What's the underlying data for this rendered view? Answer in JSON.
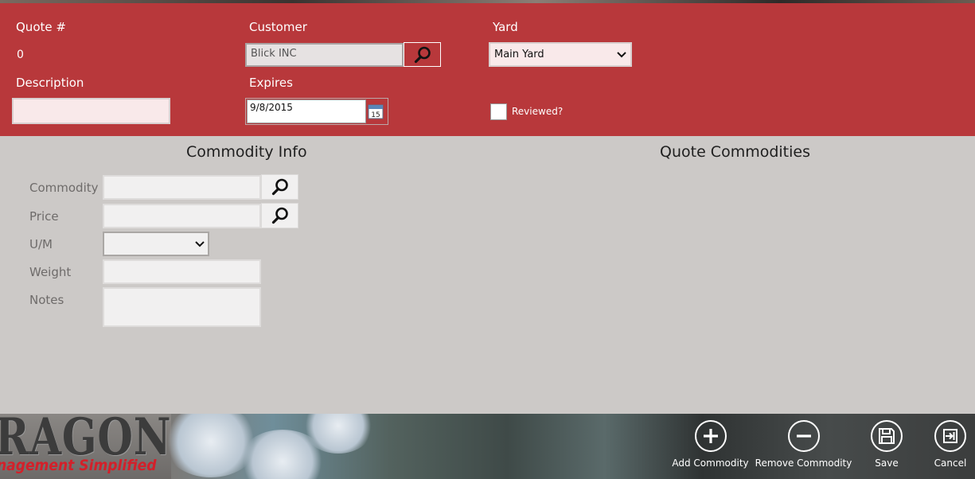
{
  "header": {
    "quote_label": "Quote #",
    "quote_value": "0",
    "description_label": "Description",
    "description_value": "",
    "customer_label": "Customer",
    "customer_value": "Blick INC",
    "expires_label": "Expires",
    "expires_value": "9/8/2015",
    "yard_label": "Yard",
    "yard_value": "Main Yard",
    "reviewed_label": "Reviewed?",
    "reviewed_checked": false
  },
  "commodity_info": {
    "title": "Commodity Info",
    "commodity_label": "Commodity",
    "price_label": "Price",
    "um_label": "U/M",
    "weight_label": "Weight",
    "notes_label": "Notes"
  },
  "quote_commodities": {
    "title": "Quote Commodities"
  },
  "footer": {
    "brand_big": "RAGON",
    "brand_small": "nagement Simplified"
  },
  "appbar": {
    "add_label": "Add Commodity",
    "remove_label": "Remove Commodity",
    "save_label": "Save",
    "cancel_label": "Cancel"
  },
  "colors": {
    "header_bg": "#b8383b",
    "content_bg": "#ccc9c7"
  }
}
